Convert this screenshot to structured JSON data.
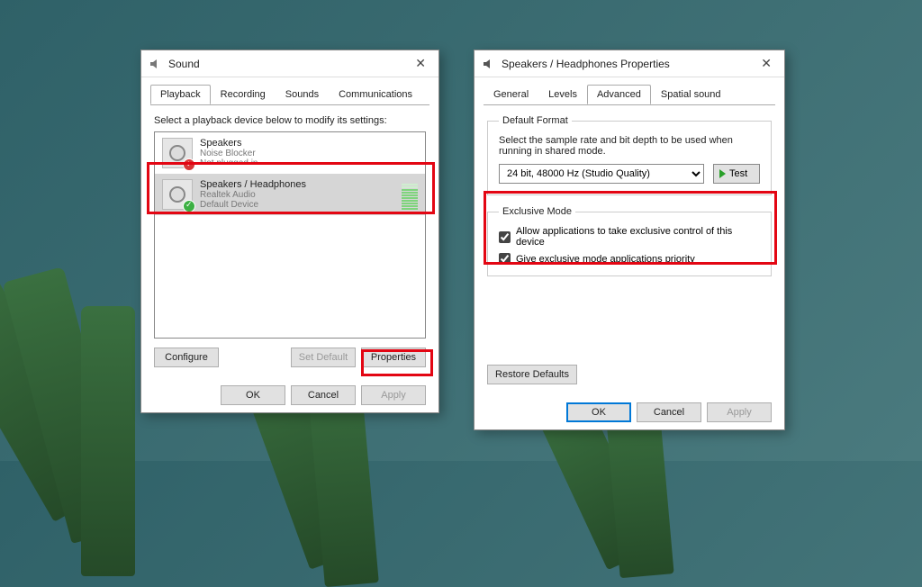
{
  "sound": {
    "title": "Sound",
    "tabs": [
      "Playback",
      "Recording",
      "Sounds",
      "Communications"
    ],
    "hint": "Select a playback device below to modify its settings:",
    "devices": [
      {
        "name": "Speakers",
        "driver": "Noise Blocker",
        "status": "Not plugged in"
      },
      {
        "name": "Speakers / Headphones",
        "driver": "Realtek Audio",
        "status": "Default Device"
      }
    ],
    "buttons": {
      "configure": "Configure",
      "setdefault": "Set Default",
      "properties": "Properties",
      "ok": "OK",
      "cancel": "Cancel",
      "apply": "Apply"
    }
  },
  "props": {
    "title": "Speakers / Headphones Properties",
    "tabs": [
      "General",
      "Levels",
      "Advanced",
      "Spatial sound"
    ],
    "format": {
      "legend": "Default Format",
      "desc": "Select the sample rate and bit depth to be used when running in shared mode.",
      "value": "24 bit, 48000 Hz (Studio Quality)",
      "test": "Test"
    },
    "exclusive": {
      "legend": "Exclusive Mode",
      "opt1": "Allow applications to take exclusive control of this device",
      "opt2": "Give exclusive mode applications priority"
    },
    "buttons": {
      "restore": "Restore Defaults",
      "ok": "OK",
      "cancel": "Cancel",
      "apply": "Apply"
    }
  }
}
